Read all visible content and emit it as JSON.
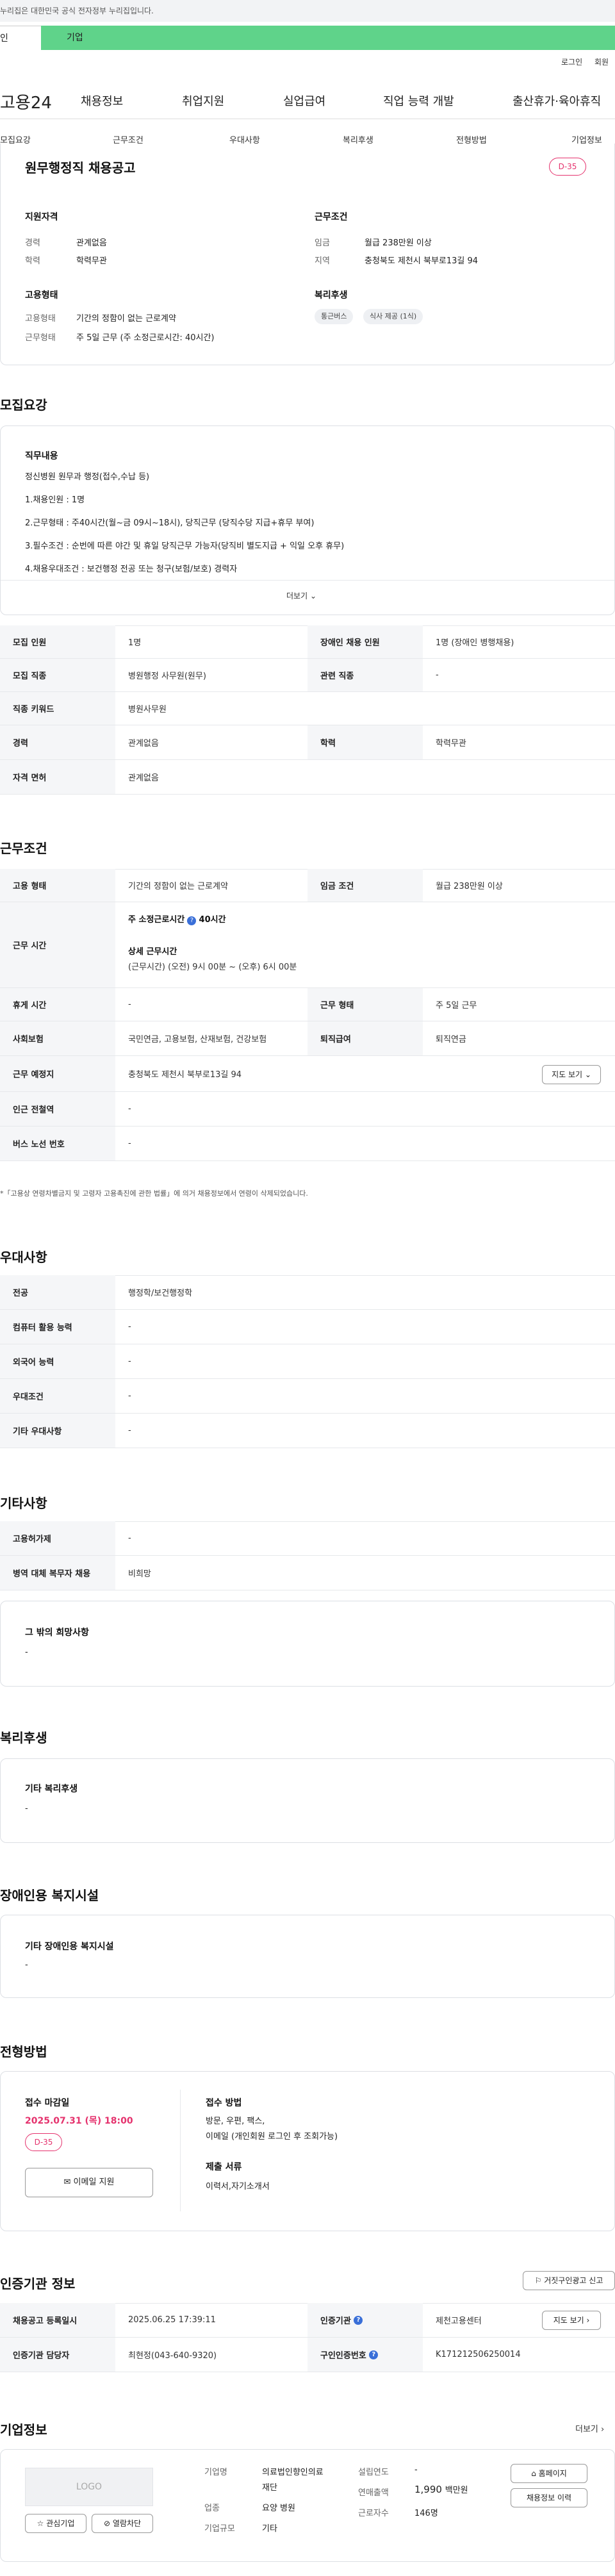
{
  "gov_banner": "누리집은 대한민국 공식 전자정부 누리집입니다.",
  "top_tabs": {
    "individual": "인",
    "business": "기업"
  },
  "util": {
    "login": "로그인",
    "signup": "회원"
  },
  "gnb": {
    "logo": "고용24",
    "items": [
      "채용정보",
      "취업지원",
      "실업급여",
      "직업 능력 개발",
      "출산휴가·육아휴직"
    ]
  },
  "subnav": [
    "모집요강",
    "근무조건",
    "우대사항",
    "복리후생",
    "전형방법",
    "기업정보"
  ],
  "summary": {
    "title": "원무행정직 채용공고",
    "dday": "D-35",
    "qual_title": "지원자격",
    "career_label": "경력",
    "career": "관계없음",
    "edu_label": "학력",
    "edu": "학력무관",
    "cond_title": "근무조건",
    "wage_label": "임금",
    "wage": "월급 238만원 이상",
    "region_label": "지역",
    "region": "충청북도 제천시 북부로13길 94",
    "emp_title": "고용형태",
    "emptype_label": "고용형태",
    "emptype": "기간의 정함이 없는 근로계약",
    "worktype_label": "근무형태",
    "worktype": "주 5일 근무 (주 소정근로시간: 40시간)",
    "welfare_title": "복리후생",
    "chips": [
      "통근버스",
      "식사 제공 (1식)"
    ]
  },
  "recruit": {
    "section": "모집요강",
    "duty_title": "직무내용",
    "lines": [
      "정신병원 원무과 행정(접수,수납 등)",
      "1.채용인원 : 1명",
      "2.근무형태 : 주40시간(월~금 09시~18시), 당직근무 (당직수당 지급+휴무 부여)",
      "3.필수조건 : 순번에 따른 야간 및 휴일 당직근무 가능자(당직비 별도지급 + 익일 오후 휴무)",
      "4.채용우대조건 : 보건행정 전공 또는 청구(보험/보호) 경력자"
    ],
    "more": "더보기",
    "table": [
      {
        "k1": "모집 인원",
        "v1": "1명",
        "k2": "장애인 채용 인원",
        "v2": "1명 (장애인 병행채용)"
      },
      {
        "k1": "모집 직종",
        "v1": "병원행정 사무원(원무)",
        "k2": "관련 직종",
        "v2": "-"
      },
      {
        "k1": "직종 키워드",
        "v1": "병원사무원",
        "k2": "",
        "v2": ""
      },
      {
        "k1": "경력",
        "v1": "관계없음",
        "k2": "학력",
        "v2": "학력무관"
      },
      {
        "k1": "자격 면허",
        "v1": "관계없음",
        "k2": "",
        "v2": ""
      }
    ]
  },
  "work": {
    "section": "근무조건",
    "emptype_k": "고용 형태",
    "emptype_v": "기간의 정함이 없는 근로계약",
    "wage_k": "임금 조건",
    "wage_v": "월급 238만원 이상",
    "time_k": "근무 시간",
    "time_main": "주 소정근로시간",
    "time_main_v": "40시간",
    "time_detail_title": "상세 근무시간",
    "time_detail": "(근무시간) (오전) 9시 00분 ~ (오후) 6시 00분",
    "holiday_k": "휴게 시간",
    "holiday_v": "-",
    "worktype_k": "근무 형태",
    "worktype_v": "주 5일 근무",
    "insurance_k": "사회보험",
    "insurance_v": "국민연금, 고용보험, 산재보험, 건강보험",
    "retire_k": "퇴직급여",
    "retire_v": "퇴직연금",
    "place_k": "근무 예정지",
    "place_v": "충청북도 제천시 북부로13길 94",
    "map_btn": "지도 보기",
    "station_k": "인근 전철역",
    "station_v": "-",
    "bus_k": "버스 노선 번호",
    "bus_v": "-",
    "note": "*「고용상 연령차별금지 및 고령자 고용촉진에 관한 법률」에 의거 채용정보에서 연령이 삭제되었습니다."
  },
  "pref": {
    "section": "우대사항",
    "rows": [
      {
        "k": "전공",
        "v": "행정학/보건행정학"
      },
      {
        "k": "컴퓨터 활용 능력",
        "v": "-"
      },
      {
        "k": "외국어 능력",
        "v": "-"
      },
      {
        "k": "우대조건",
        "v": "-"
      },
      {
        "k": "기타 우대사항",
        "v": "-"
      }
    ]
  },
  "etc": {
    "section": "기타사항",
    "rows": [
      {
        "k": "고용허가제",
        "v": "-"
      },
      {
        "k": "병역 대체 복무자 채용",
        "v": "비희망"
      }
    ],
    "other_title": "그 밖의 희망사항",
    "other_v": "-"
  },
  "welfare": {
    "section": "복리후생",
    "title": "기타 복리후생",
    "v": "-"
  },
  "disabled": {
    "section": "장애인용 복지시설",
    "title": "기타 장애인용 복지시설",
    "v": "-"
  },
  "screening": {
    "section": "전형방법",
    "deadline_title": "접수 마감일",
    "deadline": "2025.07.31 (목) 18:00",
    "dday": "D-35",
    "apply_btn": "이메일 지원",
    "method_title": "접수 방법",
    "method_v1": "방문, 우편, 팩스,",
    "method_v2": "이메일 (개인회원 로그인 후 조회가능)",
    "docs_title": "제출 서류",
    "docs_v": "이력서,자기소개서"
  },
  "cert": {
    "section": "인증기관 정보",
    "report_btn": "거짓구인광고 신고",
    "reg_k": "채용공고 등록일시",
    "reg_v": "2025.06.25 17:39:11",
    "org_k": "인증기관",
    "org_v": "제천고용센터",
    "map_btn": "지도 보기",
    "mgr_k": "인증기관 담당자",
    "mgr_v": "최현정(043-640-9320)",
    "no_k": "구인인증번호",
    "no_v": "K171212506250014"
  },
  "company": {
    "section": "기업정보",
    "more": "더보기",
    "logo": "LOGO",
    "fav_btn": "관심기업",
    "block_btn": "열람차단",
    "name_k": "기업명",
    "name_v1": "의료법인향인의료",
    "name_v2": "재단",
    "ind_k": "업종",
    "ind_v": "요양 병원",
    "size_k": "기업규모",
    "size_v": "기타",
    "year_k": "설립연도",
    "year_v": "-",
    "sales_k": "연매출액",
    "sales_v": "1,990",
    "sales_unit": "백만원",
    "emp_k": "근로자수",
    "emp_v": "146명",
    "home_btn": "홈페이지",
    "hist_btn": "채용정보 이력"
  }
}
